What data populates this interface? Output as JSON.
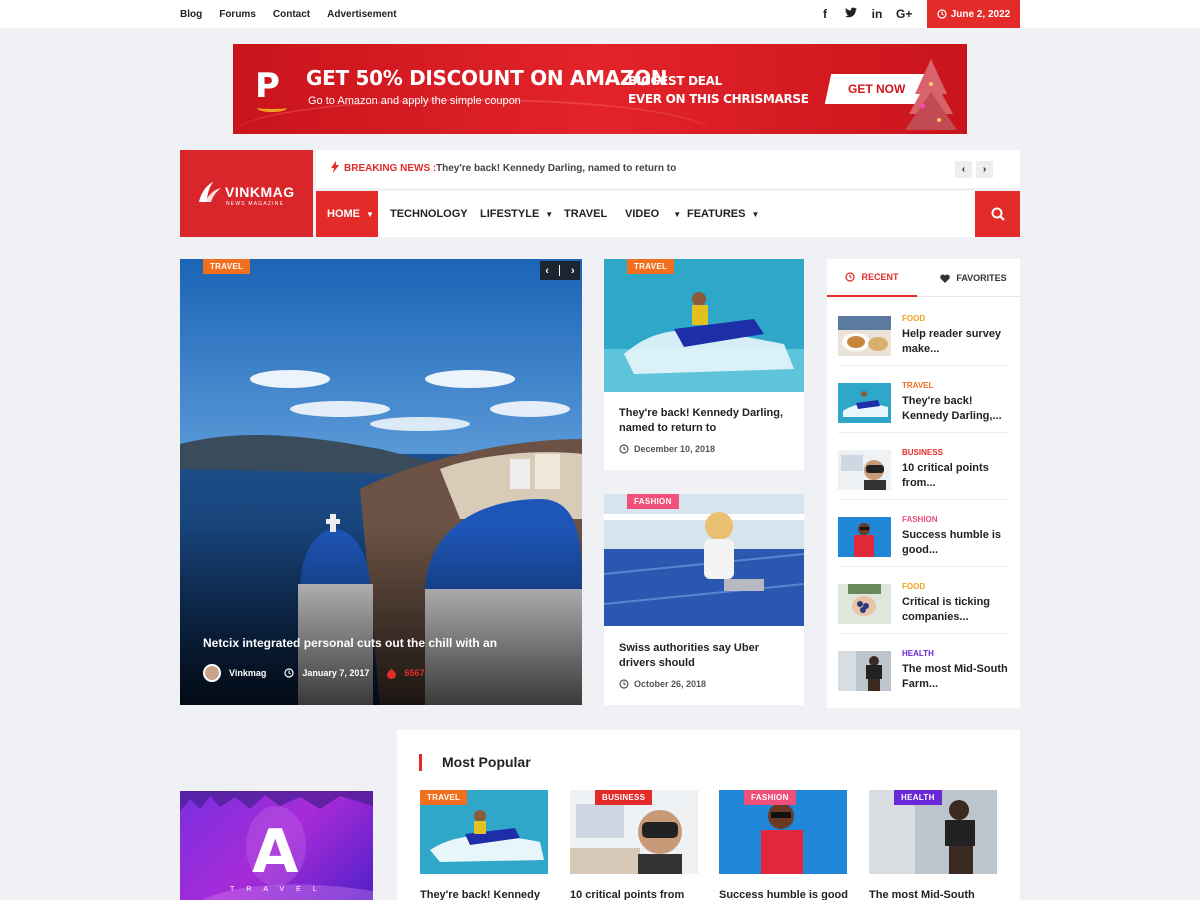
{
  "topbar": {
    "links": [
      "Blog",
      "Forums",
      "Contact",
      "Advertisement"
    ],
    "social_icons": [
      "facebook-icon",
      "twitter-icon",
      "linkedin-icon",
      "google-plus-icon"
    ],
    "social_glyphs": [
      "f",
      "t",
      "in",
      "G+"
    ],
    "date": "June 2, 2022"
  },
  "banner": {
    "headline": "GET 50% DISCOUNT ON AMAZON",
    "subtext": "Go to Amazon and apply the simple coupon",
    "deal_line1": "BIGGEST DEAL",
    "deal_line2": "EVER ON THIS CHRISMARSE",
    "button": "GET NOW",
    "logo_letter": "P"
  },
  "brand": {
    "name": "VINKMAG",
    "tagline": "NEWS MAGAZINE",
    "accent": "#e32b29"
  },
  "breaking": {
    "label": "BREAKING NEWS :",
    "text": "They're back! Kennedy Darling, named to return to"
  },
  "nav": {
    "items": [
      "HOME",
      "TECHNOLOGY",
      "LIFESTYLE",
      "TRAVEL",
      "VIDEO",
      "FEATURES"
    ]
  },
  "hero": {
    "category": "TRAVEL",
    "title": "Netcix integrated personal cuts out the chill with an",
    "author": "Vinkmag",
    "date": "January 7, 2017",
    "views": "6567"
  },
  "cards": [
    {
      "category": "TRAVEL",
      "title_line1": "They're back! Kennedy Darling,",
      "title_line2": "named to return to",
      "date": "December 10, 2018"
    },
    {
      "category": "FASHION",
      "title_line1": "Swiss authorities say Uber",
      "title_line2": "drivers should",
      "date": "October 26, 2018"
    }
  ],
  "sidebar": {
    "tabs": [
      "RECENT",
      "FAVORITES"
    ],
    "items": [
      {
        "category": "FOOD",
        "title": "Help reader survey make...",
        "color": "#f0a020"
      },
      {
        "category": "TRAVEL",
        "title": "They're back! Kennedy Darling,...",
        "color": "#f07020"
      },
      {
        "category": "BUSINESS",
        "title": "10 critical points from...",
        "color": "#e32b29"
      },
      {
        "category": "FASHION",
        "title": "Success humble is good...",
        "color": "#f0507a"
      },
      {
        "category": "FOOD",
        "title": "Critical is ticking companies...",
        "color": "#f0a020"
      },
      {
        "category": "HEALTH",
        "title": "The most Mid-South Farm...",
        "color": "#6a28d8"
      }
    ]
  },
  "popular": {
    "title": "Most Popular",
    "items": [
      {
        "category": "TRAVEL",
        "title": "They're back! Kennedy",
        "color": "#f07020"
      },
      {
        "category": "BUSINESS",
        "title": "10 critical points from",
        "color": "#e32b29"
      },
      {
        "category": "FASHION",
        "title": "Success humble is good",
        "color": "#f0507a"
      },
      {
        "category": "HEALTH",
        "title": "The most Mid-South",
        "color": "#6a28d8"
      }
    ]
  },
  "ad": {
    "letter": "A",
    "word": "TRAVEL"
  }
}
